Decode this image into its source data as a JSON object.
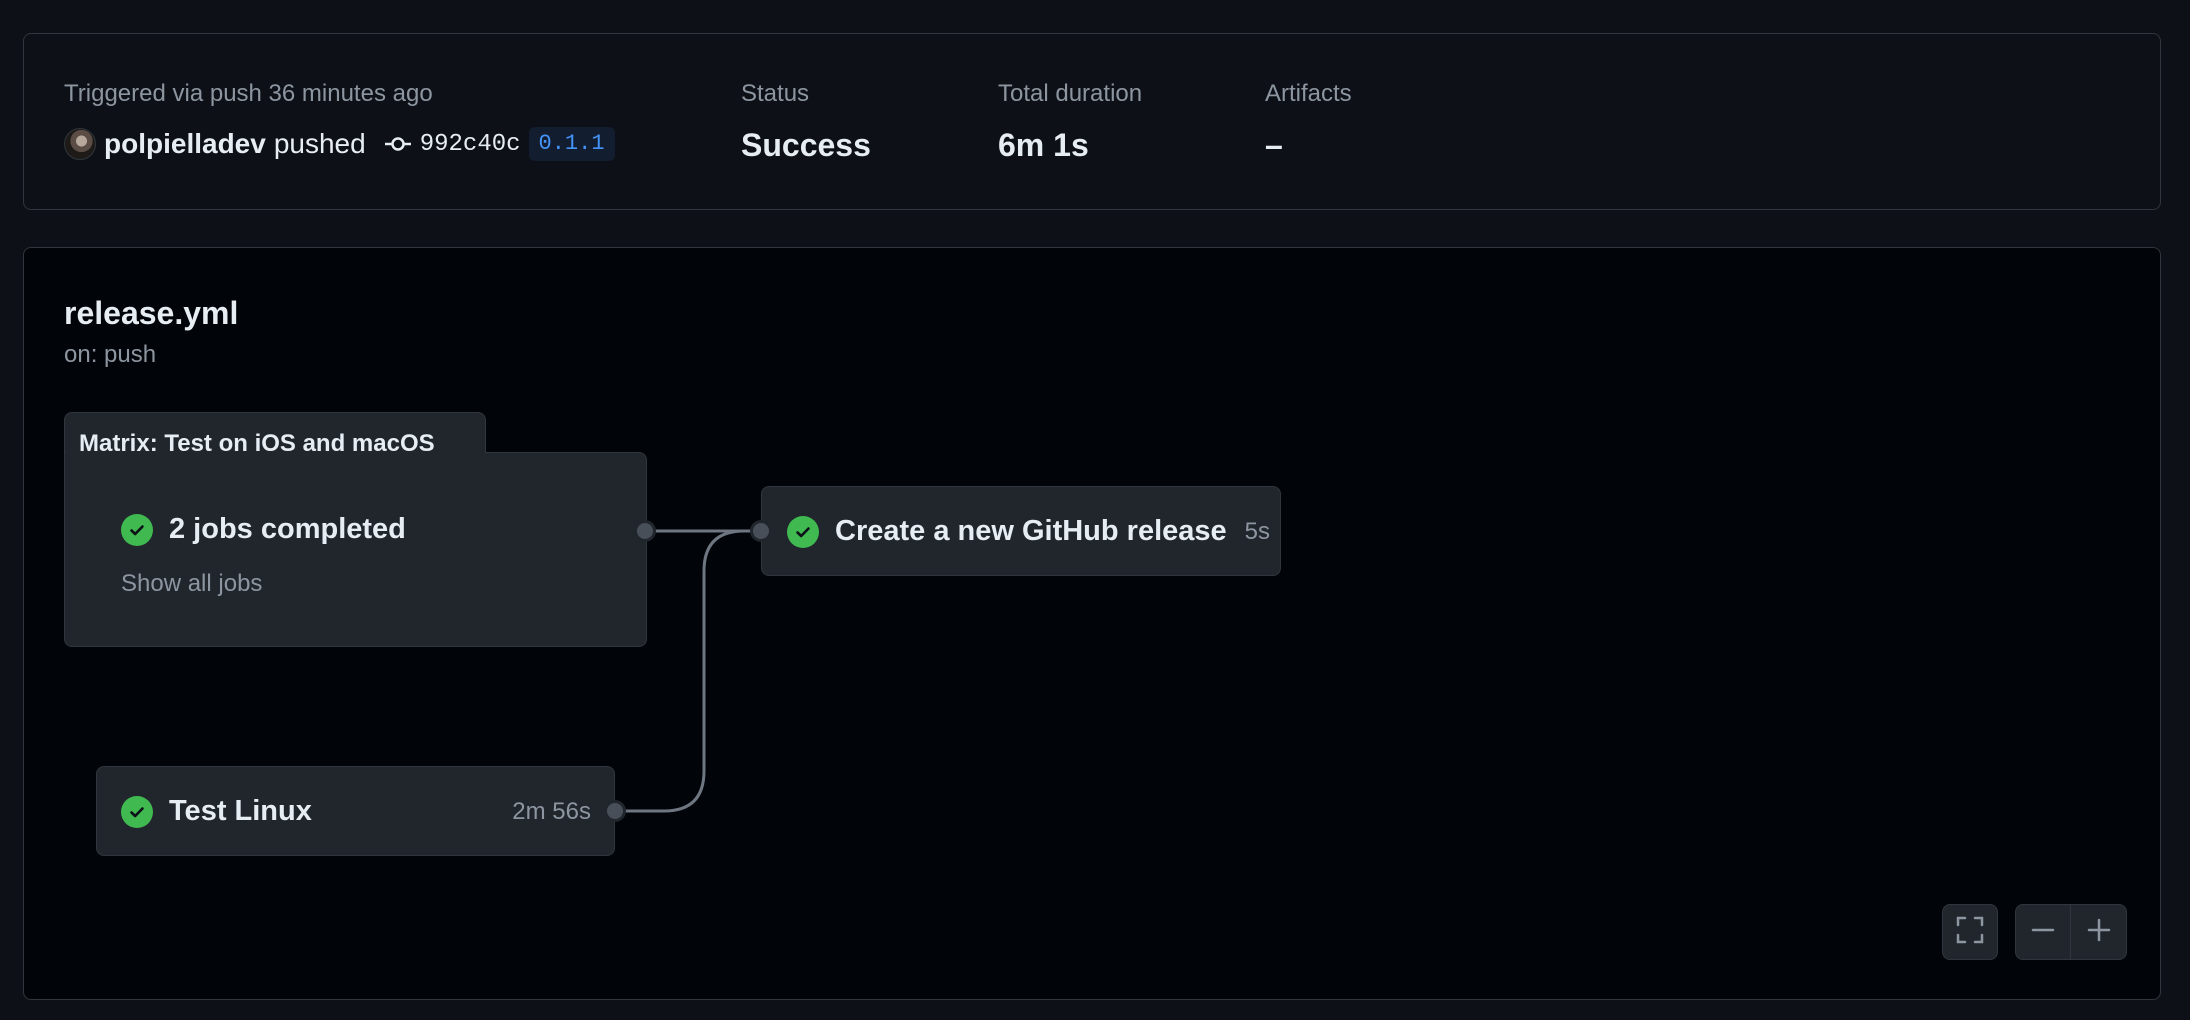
{
  "summary": {
    "trigger_text": "Triggered via push 36 minutes ago",
    "actor": "polpielladev",
    "action": "pushed",
    "commit_sha": "992c40c",
    "tag": "0.1.1",
    "status_label": "Status",
    "status_value": "Success",
    "duration_label": "Total duration",
    "duration_value": "6m 1s",
    "artifacts_label": "Artifacts",
    "artifacts_value": "–"
  },
  "workflow": {
    "name": "release.yml",
    "trigger": "on: push",
    "matrix": {
      "title": "Matrix: Test on iOS and macOS",
      "summary": "2 jobs completed",
      "show_all": "Show all jobs",
      "status": "success"
    },
    "jobs": [
      {
        "name": "Test Linux",
        "duration": "2m 56s",
        "status": "success"
      },
      {
        "name": "Create a new GitHub release",
        "duration": "5s",
        "status": "success"
      }
    ]
  },
  "controls": {
    "fullscreen_icon": "fullscreen-icon",
    "zoom_out_icon": "minus-icon",
    "zoom_in_icon": "plus-icon"
  },
  "colors": {
    "success": "#3fb950",
    "tag_blue": "#4493f8",
    "background": "#0d1117",
    "graph_background": "#010409",
    "card": "#21262d",
    "border": "#30363d"
  }
}
